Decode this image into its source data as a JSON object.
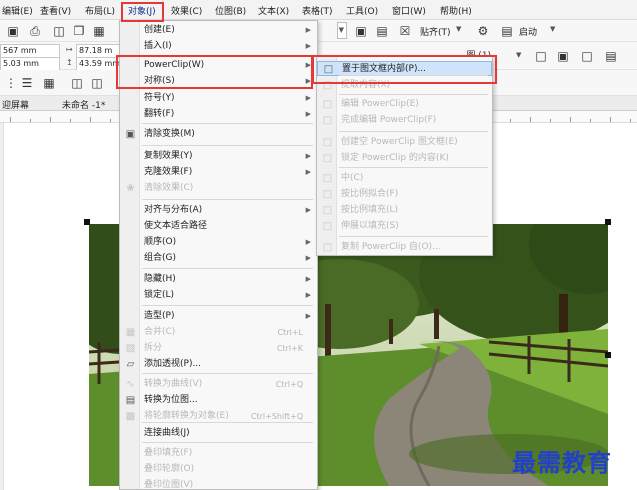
{
  "menubar": {
    "items": [
      "编辑(E)",
      "查看(V)",
      "布局(L)",
      "对象(J)",
      "效果(C)",
      "位图(B)",
      "文本(X)",
      "表格(T)",
      "工具(O)",
      "窗口(W)",
      "帮助(H)"
    ]
  },
  "toolbar": {
    "paste_label": "贴齐(T)",
    "launch_label": "启动",
    "pos_x": "567 mm",
    "pos_y": "5.03 mm",
    "size_w": "87.18 m",
    "size_h": "43.59 mm",
    "partial_label": "... 图 (1)"
  },
  "tabs": {
    "welcome": "迎屏幕",
    "untitled": "未命名 -1*"
  },
  "object_menu": {
    "items": [
      {
        "label": "创建(E)",
        "submenu": true
      },
      {
        "label": "插入(I)",
        "submenu": true
      },
      {
        "label": "PowerClip(W)",
        "submenu": true
      },
      {
        "label": "对称(S)",
        "submenu": true
      },
      {
        "label": "符号(Y)",
        "submenu": true
      },
      {
        "label": "翻转(F)",
        "submenu": true
      },
      {
        "label": "清除变换(M)",
        "icon": "clear-transform-icon"
      },
      {
        "label": "复制效果(Y)",
        "submenu": true
      },
      {
        "label": "克隆效果(F)",
        "submenu": true
      },
      {
        "label": "清除效果(C)",
        "disabled": true,
        "icon": "clear-effect-icon"
      },
      {
        "label": "对齐与分布(A)",
        "submenu": true
      },
      {
        "label": "使文本适合路径"
      },
      {
        "label": "顺序(O)",
        "submenu": true
      },
      {
        "label": "组合(G)",
        "submenu": true
      },
      {
        "label": "隐藏(H)",
        "submenu": true
      },
      {
        "label": "锁定(L)",
        "submenu": true
      },
      {
        "label": "造型(P)",
        "submenu": true
      },
      {
        "label": "合并(C)",
        "shortcut": "Ctrl+L",
        "disabled": true,
        "icon": "combine-icon"
      },
      {
        "label": "拆分",
        "shortcut": "Ctrl+K",
        "disabled": true,
        "icon": "break-apart-icon"
      },
      {
        "label": "添加透视(P)...",
        "icon": "perspective-icon"
      },
      {
        "label": "转换为曲线(V)",
        "shortcut": "Ctrl+Q",
        "disabled": true,
        "icon": "convert-curves-icon"
      },
      {
        "label": "转换为位图...",
        "icon": "convert-bitmap-icon"
      },
      {
        "label": "将轮廓转换为对象(E)",
        "shortcut": "Ctrl+Shift+Q",
        "disabled": true,
        "icon": "outline-object-icon"
      },
      {
        "label": "连接曲线(J)"
      },
      {
        "label": "叠印填充(F)",
        "disabled": true
      },
      {
        "label": "叠印轮廓(O)",
        "disabled": true
      },
      {
        "label": "叠印位图(V)",
        "disabled": true
      }
    ]
  },
  "powerclip_menu": {
    "items": [
      {
        "label": "置于图文框内部(P)...",
        "highlighted": true
      },
      {
        "label": "提取内容(X)",
        "disabled": true
      },
      {
        "label": "编辑 PowerClip(E)",
        "disabled": true
      },
      {
        "label": "完成编辑 PowerClip(F)",
        "disabled": true
      },
      {
        "label": "创建空 PowerClip 图文框(E)",
        "disabled": true
      },
      {
        "label": "锁定 PowerClip 的内容(K)",
        "disabled": true
      },
      {
        "label": "中(C)",
        "disabled": true
      },
      {
        "label": "按比例拟合(F)",
        "disabled": true
      },
      {
        "label": "按比例填充(L)",
        "disabled": true
      },
      {
        "label": "伸展以填充(S)",
        "disabled": true
      },
      {
        "label": "复制 PowerClip 自(O)...",
        "disabled": true
      }
    ]
  },
  "watermark": "最需教育",
  "colors": {
    "highlight": "#cfe4fb",
    "annotation": "#e53935",
    "watermark": "#2340c8"
  }
}
